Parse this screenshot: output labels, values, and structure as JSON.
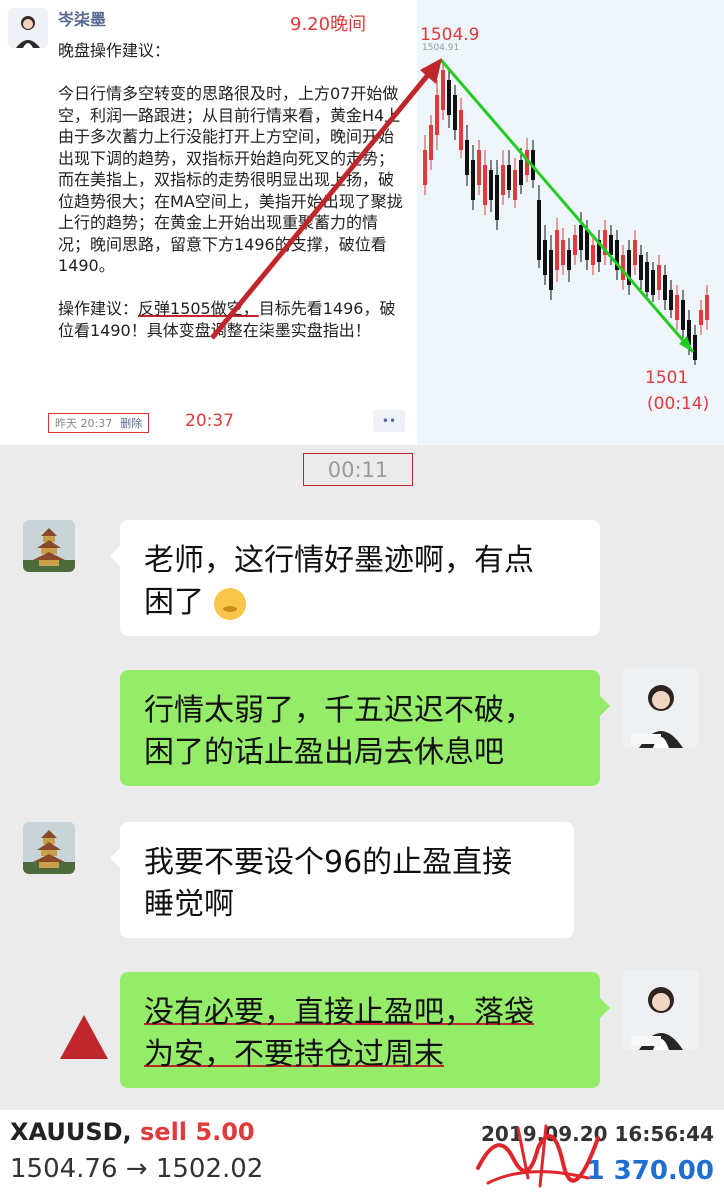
{
  "post": {
    "author": "岑柒墨",
    "annotation_date": "9.20晚间",
    "title": "晚盘操作建议：",
    "body_p1": "今日行情多空转变的思路很及时，上方07开始做空，利润一路跟进；从目前行情来看，黄金H4上由于多次蓄力上行没能打开上方空间，晚间开始出现下调的趋势，双指标开始趋向死叉的走势；而在美指上，双指标的走势很明显出现上扬，破位趋势很大；在MA空间上，美指开始出现了聚拢上行的趋势；在黄金上开始出现重聚蓄力的情况；晚间思路，留意下方1496的支撑，破位看1490。",
    "body_p2_prefix": "操作建议：",
    "body_p2_underlined": "反弹1505做空，",
    "body_p2_rest": "目标先看1496，破位看1490！具体变盘调整在柒墨实盘指出！",
    "meta_time": "昨天 20:37",
    "meta_delete": "删除",
    "annotation_time": "20:37",
    "more_label": "••"
  },
  "chart": {
    "high_label": "1504.9",
    "high_small": "1504.91",
    "low_label": "1501",
    "low_time": "(00:14)",
    "colors": {
      "up": "#e03a3a",
      "down": "#111111",
      "arrow_red": "#c0272d",
      "arrow_green": "#22cc22"
    }
  },
  "chat": {
    "time_tag": "00:11",
    "messages": [
      {
        "side": "left",
        "text_line1": "老师，这行情好墨迹啊，有点",
        "text_line2": "困了"
      },
      {
        "side": "right",
        "text_line1": "行情太弱了，千五迟迟不破，",
        "text_line2": "困了的话止盈出局去休息吧"
      },
      {
        "side": "left",
        "text_line1": "我要不要设个96的止盈直接",
        "text_line2": "睡觉啊"
      },
      {
        "side": "right",
        "text_line1": "没有必要，直接止盈吧，落袋",
        "text_line2": "为安，不要持仓过周末"
      }
    ]
  },
  "trade": {
    "symbol": "XAUUSD,",
    "side": "sell 5.00",
    "prices": "1504.76 → 1502.02",
    "datetime": "2019.09.20 16:56:44",
    "profit": "1 370.00"
  }
}
